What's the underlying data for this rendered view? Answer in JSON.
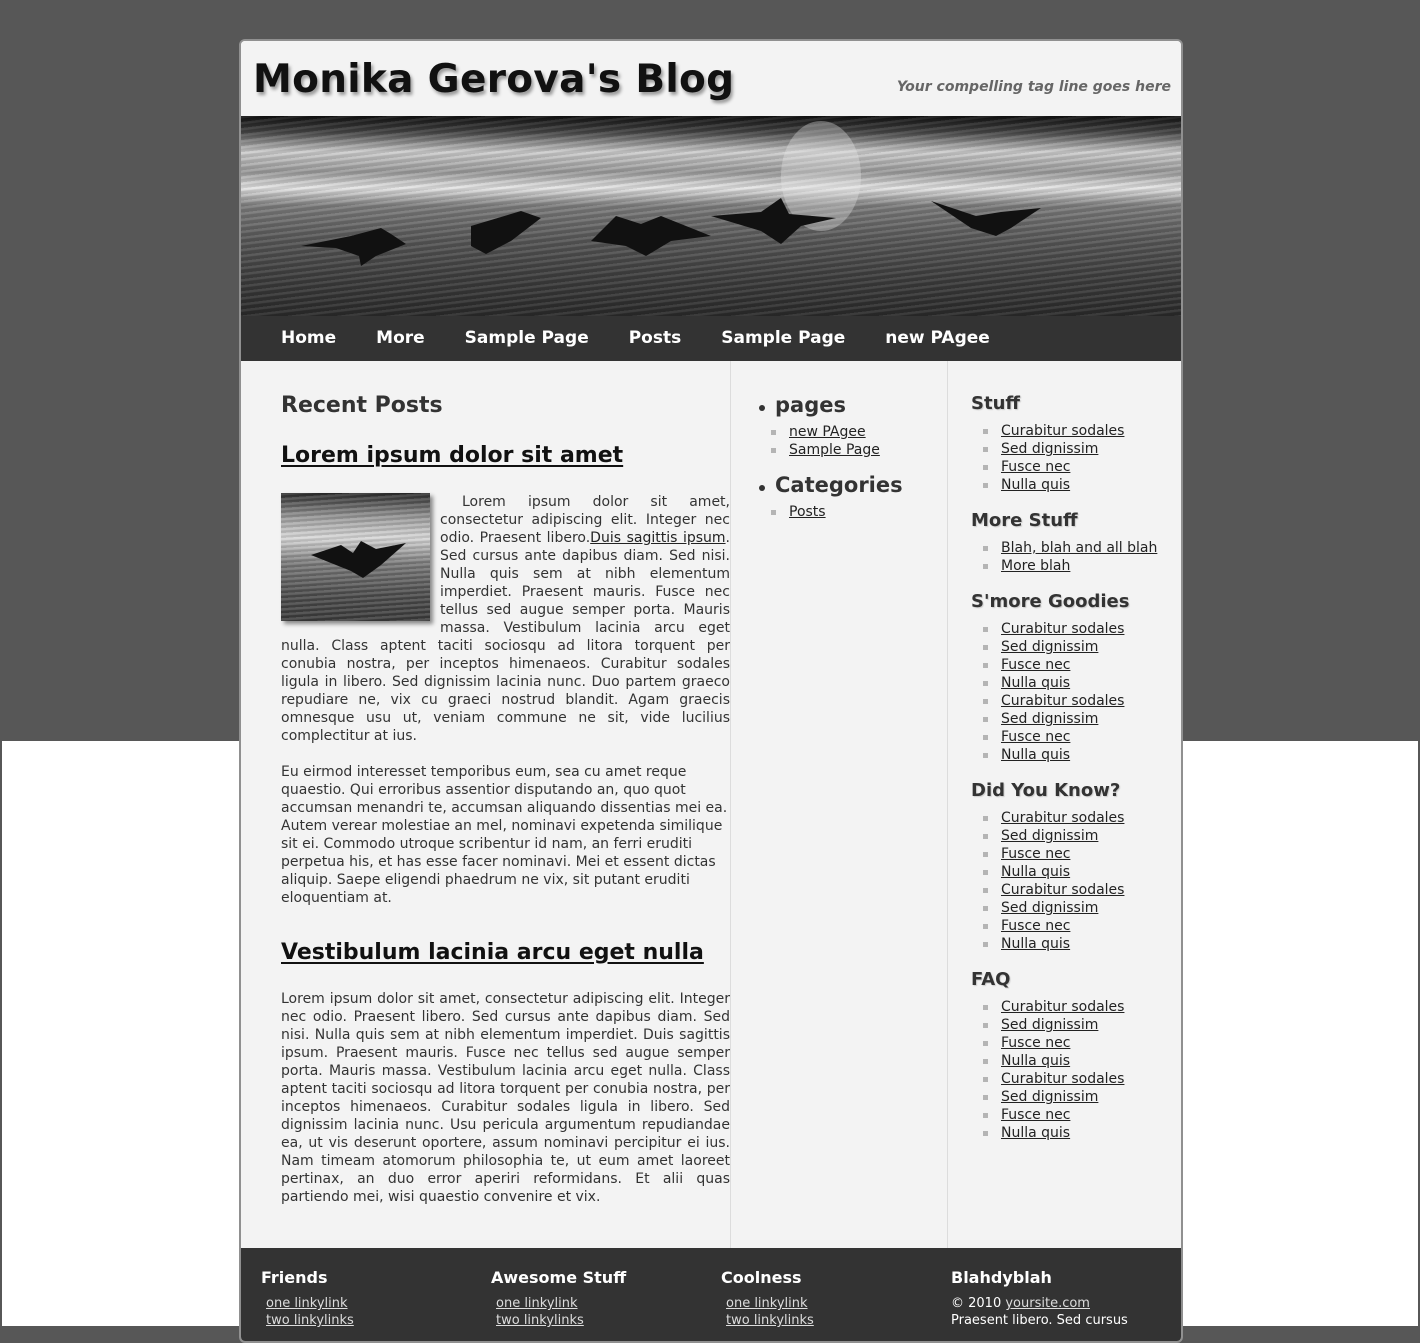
{
  "site": {
    "title": "Monika Gerova's Blog",
    "tagline": "Your compelling tag line goes here"
  },
  "nav": [
    "Home",
    "More",
    "Sample Page",
    "Posts",
    "Sample Page",
    "new PAgee"
  ],
  "main": {
    "section_title": "Recent Posts",
    "post1": {
      "title": "Lorem ipsum dolor sit amet",
      "p1_before": "Lorem ipsum dolor sit amet, consectetur adipiscing elit. Integer nec odio. Praesent libero.",
      "p1_link": "Duis sagittis ipsum",
      "p1_after": ". Sed cursus ante dapibus diam. Sed nisi. Nulla quis sem at nibh elementum imperdiet. Praesent mauris. Fusce nec tellus sed augue semper porta. Mauris massa. Vestibulum lacinia arcu eget nulla. Class aptent taciti sociosqu ad litora torquent per conubia nostra, per inceptos himenaeos. Curabitur sodales ligula in libero. Sed dignissim lacinia nunc. Duo partem graeco repudiare ne, vix cu graeci nostrud blandit. Agam graecis omnesque usu ut, veniam commune ne sit, vide lucilius complectitur at ius.",
      "p2": "Eu eirmod interesset temporibus eum, sea cu amet reque quaestio. Qui erroribus assentior disputando an, quo quot accumsan menandri te, accumsan aliquando dissentias mei ea. Autem verear molestiae an mel, nominavi expetenda similique sit ei. Commodo utroque scribentur id nam, an ferri eruditi perpetua his, et has esse facer nominavi. Mei et essent dictas aliquip. Saepe eligendi phaedrum ne vix, sit putant eruditi eloquentiam at."
    },
    "post2": {
      "title": "Vestibulum lacinia arcu eget nulla",
      "p1": "Lorem ipsum dolor sit amet, consectetur adipiscing elit. Integer nec odio. Praesent libero. Sed cursus ante dapibus diam. Sed nisi. Nulla quis sem at nibh elementum imperdiet. Duis sagittis ipsum. Praesent mauris. Fusce nec tellus sed augue semper porta. Mauris massa. Vestibulum lacinia arcu eget nulla. Class aptent taciti sociosqu ad litora torquent per conubia nostra, per inceptos himenaeos. Curabitur sodales ligula in libero. Sed dignissim lacinia nunc. Usu pericula argumentum repudiandae ea, ut vis deserunt oportere, assum nominavi percipitur ei ius. Nam timeam atomorum philosophia te, ut eum amet laoreet pertinax, an duo error aperiri reformidans. Et alii quas partiendo mei, wisi quaestio convenire et vix."
    }
  },
  "pages_widget": {
    "title": "pages",
    "items": [
      "new PAgee",
      "Sample Page"
    ]
  },
  "categories_widget": {
    "title": "Categories",
    "items": [
      "Posts"
    ]
  },
  "sidebar": {
    "stuff": {
      "title": "Stuff",
      "items": [
        "Curabitur sodales",
        "Sed dignissim",
        "Fusce nec",
        "Nulla quis"
      ]
    },
    "more_stuff": {
      "title": "More Stuff",
      "items": [
        "Blah, blah and all blah",
        "More blah"
      ]
    },
    "smore": {
      "title": "S'more Goodies",
      "items": [
        "Curabitur sodales",
        "Sed dignissim",
        "Fusce nec",
        "Nulla quis",
        "Curabitur sodales",
        "Sed dignissim",
        "Fusce nec",
        "Nulla quis"
      ]
    },
    "did_you_know": {
      "title": "Did You Know?",
      "items": [
        "Curabitur sodales",
        "Sed dignissim",
        "Fusce nec",
        "Nulla quis",
        "Curabitur sodales",
        "Sed dignissim",
        "Fusce nec",
        "Nulla quis"
      ]
    },
    "faq": {
      "title": "FAQ",
      "items": [
        "Curabitur sodales",
        "Sed dignissim",
        "Fusce nec",
        "Nulla quis",
        "Curabitur sodales",
        "Sed dignissim",
        "Fusce nec",
        "Nulla quis"
      ]
    }
  },
  "footer": {
    "friends": {
      "title": "Friends",
      "links": [
        "one linkylink",
        "two linkylinks"
      ]
    },
    "awesome": {
      "title": "Awesome Stuff",
      "links": [
        "one linkylink",
        "two linkylinks"
      ]
    },
    "coolness": {
      "title": "Coolness",
      "links": [
        "one linkylink",
        "two linkylinks"
      ]
    },
    "blahdy": {
      "title": "Blahdyblah",
      "copyright_prefix": "© 2010 ",
      "copyright_link": "yoursite.com",
      "text": "Praesent libero. Sed cursus"
    }
  },
  "colors": {
    "page_bg": "#575757",
    "container_bg": "#f3f3f3",
    "nav_bg": "#333333",
    "footer_bg": "#333333",
    "text": "#333333"
  },
  "icons": {
    "list_bullet": "square-bullet-icon",
    "heading_bullet": "round-bullet-icon"
  }
}
